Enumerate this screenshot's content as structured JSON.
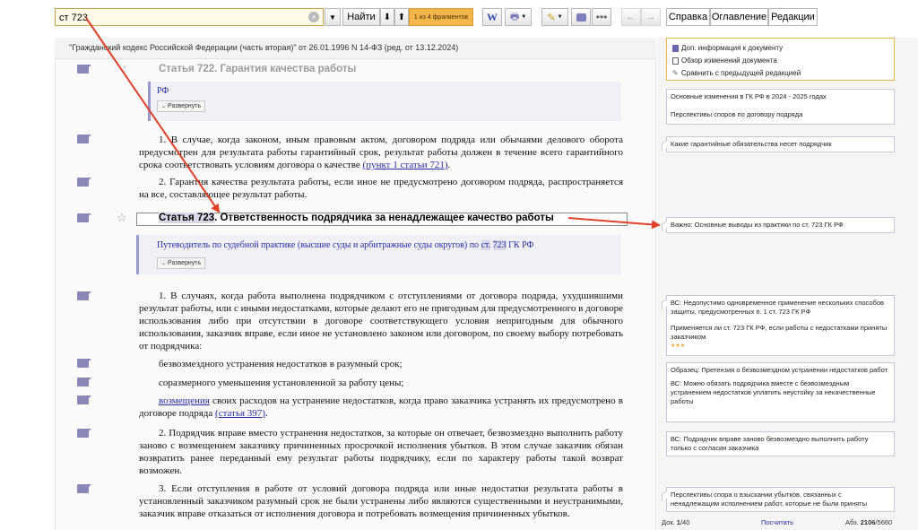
{
  "toolbar": {
    "search_value": "ст 723",
    "find_label": "Найти",
    "fragments": "1 из 4 фрагментов",
    "tabs": [
      "Справка",
      "Оглавление",
      "Редакции"
    ]
  },
  "doc": {
    "header": "\"Гражданский кодекс Российской Федерации (часть вторая)\" от 26.01.1996 N 14-ФЗ (ред. от 13.12.2024)",
    "art722_title": "Статья 722. Гарантия качества работы",
    "rf_link": "РФ",
    "expand_label": "Развернуть",
    "p722_1a": "1. В случае, когда законом, иным правовым актом, договором подряда или обычаями делового оборота предусмотрен для результата работы гарантийный срок, результат работы должен в течение всего гарантийного срока соответствовать условиям договора о качестве ",
    "p722_1_link": "(пункт 1 статьи 721)",
    "p722_1b": ".",
    "p722_2": "2. Гарантия качества результата работы, если иное не предусмотрено договором подряда, распространяется на все, составляющее результат работы.",
    "art723_prefix": "Статья ",
    "art723_num": "723",
    "art723_rest": ". Ответственность подрядчика за ненадлежащее качество работы",
    "guide_a": "Путеводитель по судебной практике (высшие суды и арбитражные суды округов) по ",
    "guide_st": "ст.",
    "guide_num": "723",
    "guide_end": " ГК РФ",
    "p723_1": "1. В случаях, когда работа выполнена подрядчиком с отступлениями от договора подряда, ухудшившими результат работы, или с иными недостатками, которые делают его не пригодным для предусмотренного в договоре использования либо при отсутствии в договоре соответствующего условия непригодным для обычного использования, заказчик вправе, если иное не установлено законом или договором, по своему выбору потребовать от подрядчика:",
    "p723_1a": "безвозмездного устранения недостатков в разумный срок;",
    "p723_1b": "соразмерного уменьшения установленной за работу цены;",
    "p723_1c_link": "возмещения",
    "p723_1c": " своих расходов на устранение недостатков, когда право заказчика устранять их предусмотрено в договоре подряда ",
    "p723_1c_link2": "(статья 397)",
    "p723_1c_end": ".",
    "p723_2": "2. Подрядчик вправе вместо устранения недостатков, за которые он отвечает, безвозмездно выполнить работу заново с возмещением заказчику причиненных просрочкой исполнения убытков. В этом случае заказчик обязан возвратить ранее переданный ему результат работы подрядчику, если по характеру работы такой возврат возможен.",
    "p723_3": "3. Если отступления в работе от условий договора подряда или иные недостатки результата работы в установленный заказчиком разумный срок не были устранены либо являются существенными и неустранимыми, заказчик вправе отказаться от исполнения договора и потребовать возмещения причиненных убытков."
  },
  "right": {
    "top_links": [
      "Доп. информация к документу",
      "Обзор изменений документа",
      "Сравнить с предыдущей редакцией"
    ],
    "card1_a": "Основные изменения в ГК РФ в 2024 - 2025 годах",
    "card1_b": "Перспективы споров по договору подряда",
    "card2": "Какие гарантийные обязательства несет подрядчик",
    "card3": "Важно: Основные выводы из практики по ст. 723 ГК РФ",
    "card4_a": "ВС: Недопустимо одновременное применение нескольких способов защиты, предусмотренных п. 1 ст. 723 ГК РФ",
    "card4_b": "Применяется ли ст. 723 ГК РФ, если работы с недостатками приняты заказчиком",
    "card4_stars": "★★★",
    "card5_a": "Образец: Претензия о безвозмездном устранении недостатков работ",
    "card5_b": "ВС: Можно обязать подрядчика вместе с безвозмездным устранением недостатков уплатить неустойку за некачественные работы",
    "card6": "ВС: Подрядчик вправе заново безвозмездно выполнить работу только с согласия заказчика",
    "card7": "Перспективы спора о взыскании убытков, связанных с ненадлежащим исполнением работ, которые не были приняты",
    "status_doc_label": "Док. ",
    "status_doc": "1",
    "status_doc_total": "/40",
    "status_count": "Посчитать",
    "status_abz_label": "Абз. ",
    "status_abz": "2106",
    "status_abz_total": "/5660"
  },
  "colors": {
    "accent": "#f2b64a",
    "marker": "#8a86b5",
    "arrow": "#e0412b",
    "link": "#2a2aa8"
  }
}
